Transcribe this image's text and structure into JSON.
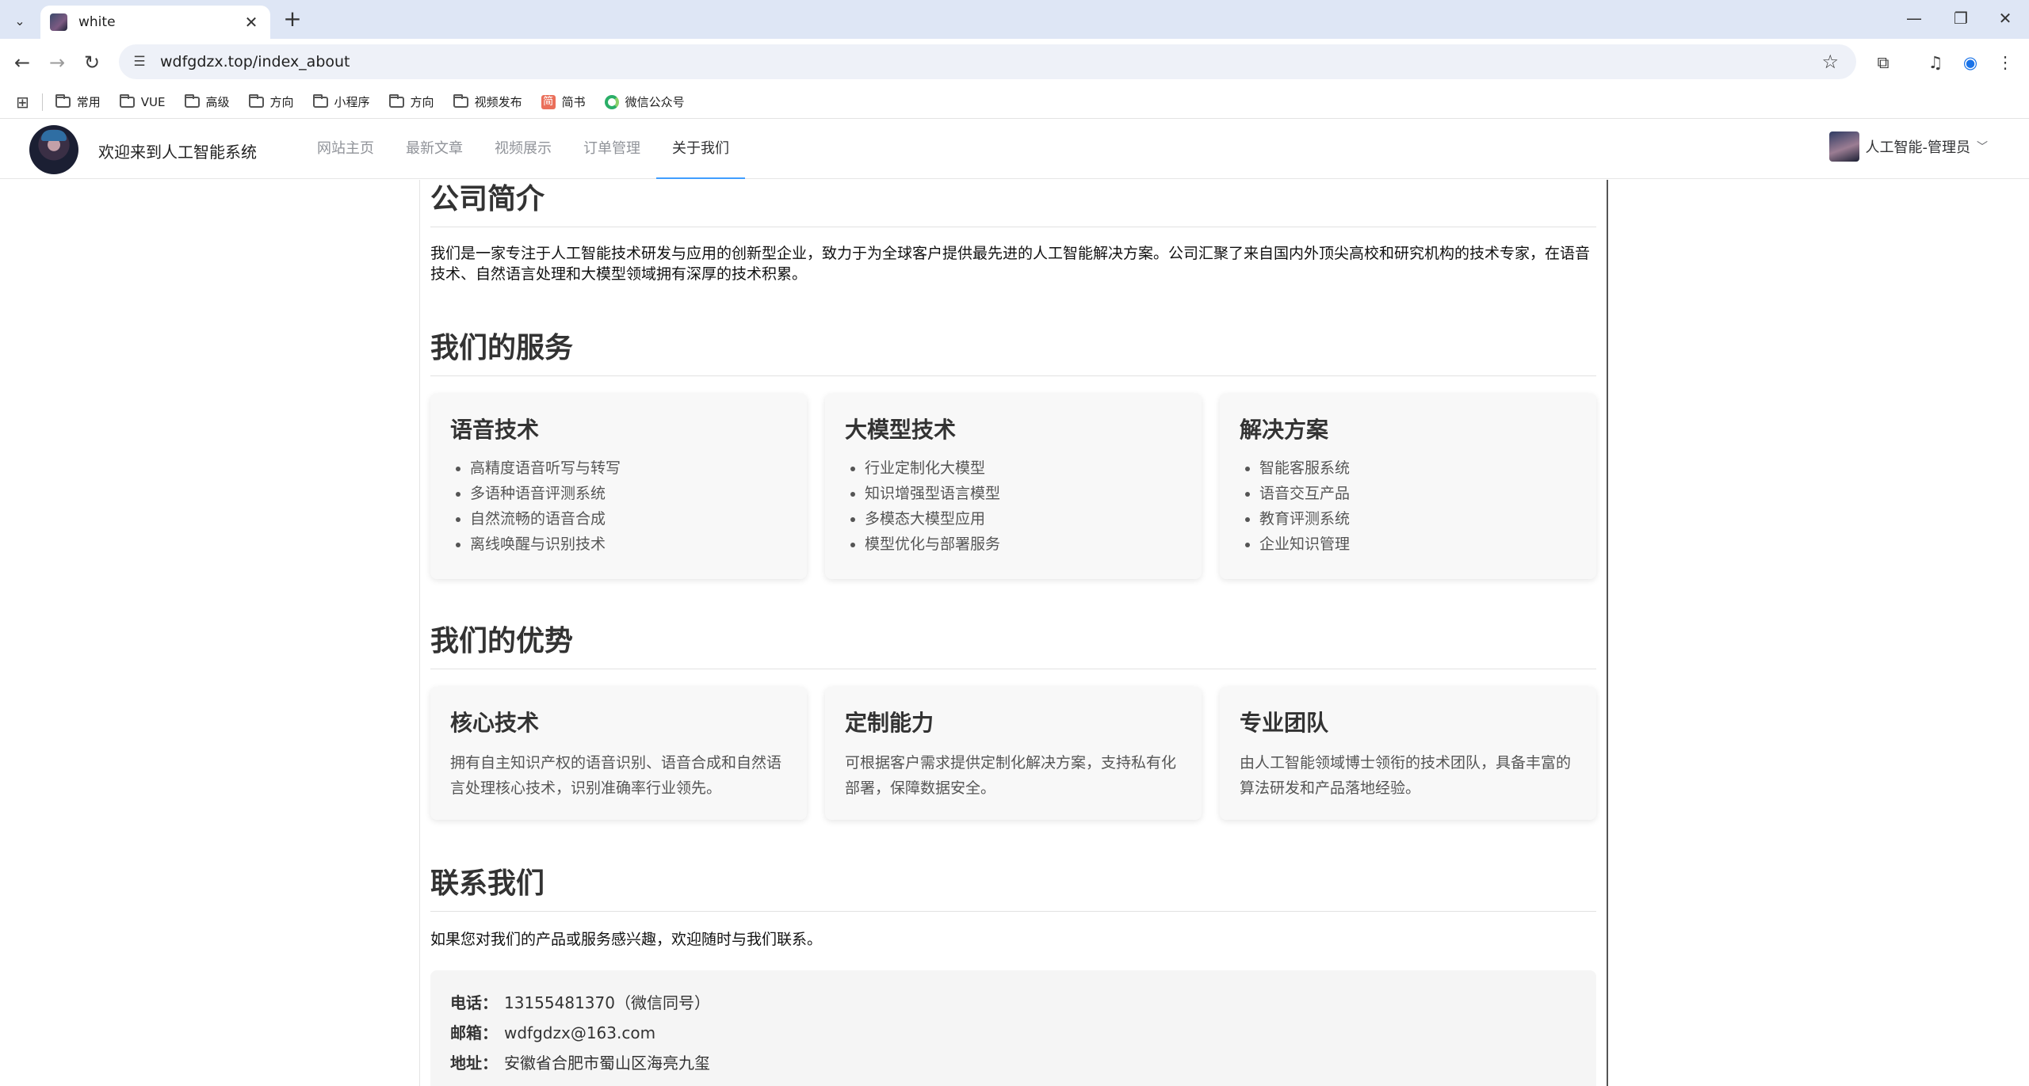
{
  "browser": {
    "tab_title": "white",
    "url": "wdfgdzx.top/index_about",
    "bookmarks": [
      "常用",
      "VUE",
      "高级",
      "方向",
      "小程序",
      "方向",
      "视频发布",
      "简书",
      "微信公众号"
    ]
  },
  "site": {
    "title": "欢迎来到人工智能系统",
    "menu": [
      "网站主页",
      "最新文章",
      "视频展示",
      "订单管理",
      "关于我们"
    ],
    "active_menu": "关于我们",
    "user_name": "人工智能-管理员"
  },
  "about": {
    "company_title": "公司简介",
    "company_intro": "我们是一家专注于人工智能技术研发与应用的创新型企业，致力于为全球客户提供最先进的人工智能解决方案。公司汇聚了来自国内外顶尖高校和研究机构的技术专家，在语音技术、自然语言处理和大模型领域拥有深厚的技术积累。",
    "services_title": "我们的服务",
    "services": [
      {
        "title": "语音技术",
        "items": [
          "高精度语音听写与转写",
          "多语种语音评测系统",
          "自然流畅的语音合成",
          "离线唤醒与识别技术"
        ]
      },
      {
        "title": "大模型技术",
        "items": [
          "行业定制化大模型",
          "知识增强型语言模型",
          "多模态大模型应用",
          "模型优化与部署服务"
        ]
      },
      {
        "title": "解决方案",
        "items": [
          "智能客服系统",
          "语音交互产品",
          "教育评测系统",
          "企业知识管理"
        ]
      }
    ],
    "advantages_title": "我们的优势",
    "advantages": [
      {
        "title": "核心技术",
        "desc": "拥有自主知识产权的语音识别、语音合成和自然语言处理核心技术，识别准确率行业领先。"
      },
      {
        "title": "定制能力",
        "desc": "可根据客户需求提供定制化解决方案，支持私有化部署，保障数据安全。"
      },
      {
        "title": "专业团队",
        "desc": "由人工智能领域博士领衔的技术团队，具备丰富的算法研发和产品落地经验。"
      }
    ],
    "contact_title": "联系我们",
    "contact_intro": "如果您对我们的产品或服务感兴趣，欢迎随时与我们联系。",
    "contact": {
      "phone_label": "电话：",
      "phone": "13155481370（微信同号）",
      "email_label": "邮箱：",
      "email": "wdfgdzx@163.com",
      "address_label": "地址：",
      "address": "安徽省合肥市蜀山区海亮九玺"
    }
  },
  "colors": {
    "accent": "#409eff",
    "tab_strip": "#dee6f5",
    "card_bg": "#f8f8f8"
  }
}
